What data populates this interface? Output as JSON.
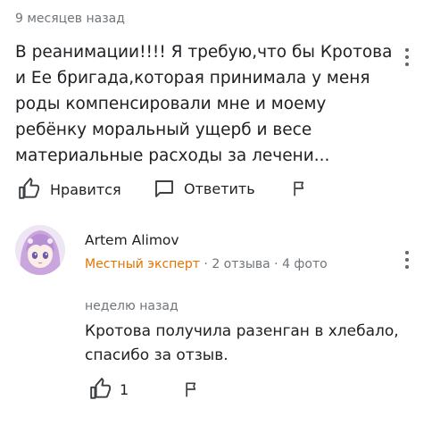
{
  "review": {
    "time": "9 месяцев назад",
    "text": "В реанимации!!!! Я требую,что бы Кротова и Ее бригада,которая принимала у меня роды компенсировали мне и моему ребёнку моральный ущерб и весе материальные расходы за лечени...",
    "like_label": "Нравится",
    "reply_label": "Ответить"
  },
  "reply": {
    "author": "Artem Alimov",
    "badge": "Местный эксперт",
    "separator": "·",
    "reviews_count": "2 отзыва",
    "photos_count": "4 фото",
    "time": "неделю назад",
    "text": "Кротова получила разенган в хлебало, спасибо за отзыв.",
    "likes": "1"
  },
  "colors": {
    "local_guide": "#e37400",
    "secondary_text": "#70757a",
    "icon": "#3c4043"
  },
  "icons": [
    "thumb-up-icon",
    "comment-icon",
    "flag-icon",
    "more-vert-icon"
  ]
}
